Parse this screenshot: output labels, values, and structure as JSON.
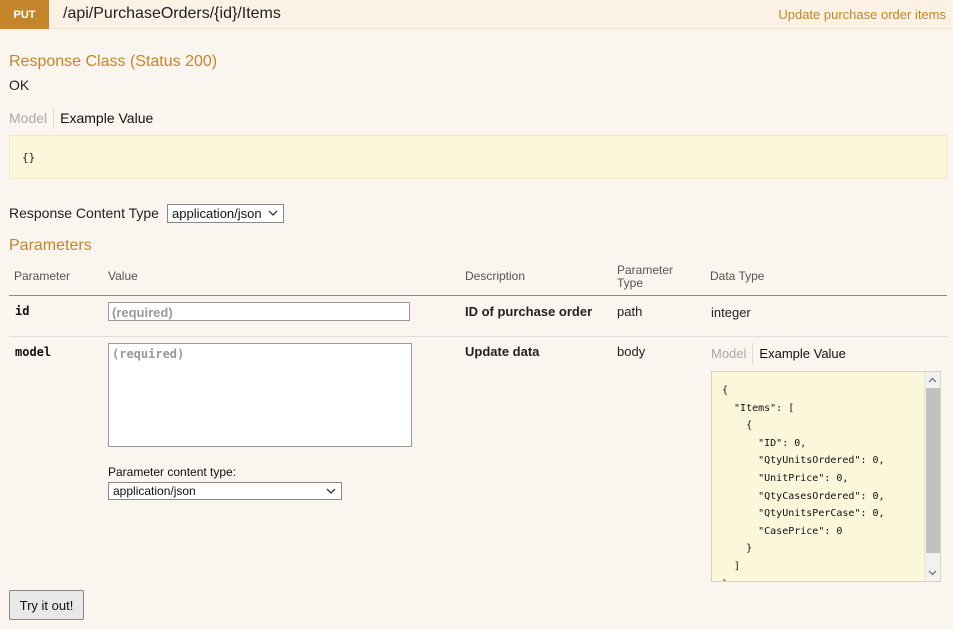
{
  "operation": {
    "method": "PUT",
    "path": "/api/PurchaseOrders/{id}/Items",
    "summary": "Update purchase order items"
  },
  "response": {
    "title": "Response Class (Status 200)",
    "status_text": "OK",
    "tabs": {
      "model": "Model",
      "example": "Example Value"
    },
    "example_value": "{}"
  },
  "content_type": {
    "label": "Response Content Type",
    "selected": "application/json"
  },
  "parameters": {
    "title": "Parameters",
    "headers": {
      "parameter": "Parameter",
      "value": "Value",
      "description": "Description",
      "param_type_line1": "Parameter",
      "param_type_line2": "Type",
      "data_type": "Data Type"
    },
    "rows": [
      {
        "name": "id",
        "placeholder": "(required)",
        "description": "ID of purchase order",
        "param_type": "path",
        "data_type": "integer"
      },
      {
        "name": "model",
        "placeholder": "(required)",
        "description": "Update data",
        "param_type": "body",
        "content_type_label": "Parameter content type:",
        "content_type_selected": "application/json",
        "tabs": {
          "model": "Model",
          "example": "Example Value"
        },
        "example_json": "{\n  \"Items\": [\n    {\n      \"ID\": 0,\n      \"QtyUnitsOrdered\": 0,\n      \"UnitPrice\": 0,\n      \"QtyCasesOrdered\": 0,\n      \"QtyUnitsPerCase\": 0,\n      \"CasePrice\": 0\n    }\n  ]\n}"
      }
    ]
  },
  "try_button": "Try it out!",
  "icons": {
    "dropdown": "chevron-down-icon",
    "scroll_up": "scroll-up-arrow-icon",
    "scroll_down": "scroll-down-arrow-icon"
  },
  "colors": {
    "accent": "#c5862b",
    "background": "#faf5ee",
    "example_bg": "#fcf6db"
  }
}
